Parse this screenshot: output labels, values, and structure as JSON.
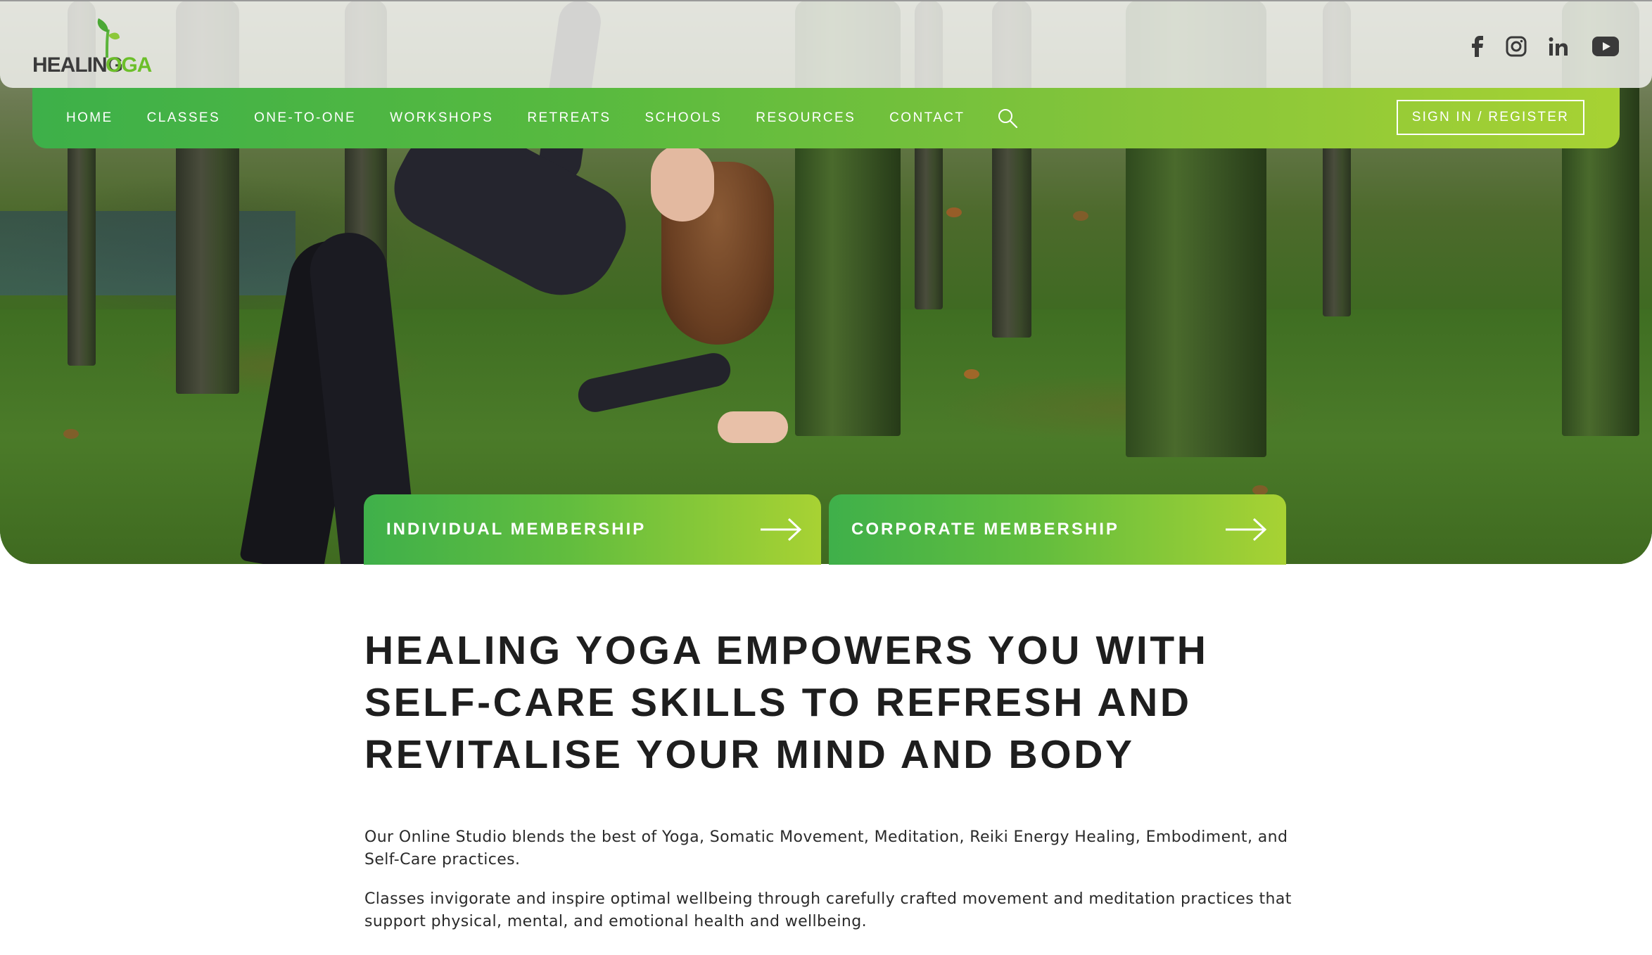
{
  "brand": {
    "logo_text_left": "HEALING",
    "logo_text_right": "OGA",
    "accent_green": "#5bbf3f",
    "accent_lime": "#a7d233"
  },
  "social": [
    {
      "name": "facebook",
      "icon": "facebook-icon"
    },
    {
      "name": "instagram",
      "icon": "instagram-icon"
    },
    {
      "name": "linkedin",
      "icon": "linkedin-icon"
    },
    {
      "name": "youtube",
      "icon": "youtube-icon"
    }
  ],
  "nav": {
    "items": [
      {
        "label": "HOME"
      },
      {
        "label": "CLASSES"
      },
      {
        "label": "ONE-TO-ONE"
      },
      {
        "label": "WORKSHOPS"
      },
      {
        "label": "RETREATS"
      },
      {
        "label": "SCHOOLS"
      },
      {
        "label": "RESOURCES"
      },
      {
        "label": "CONTACT"
      }
    ],
    "search_icon": "search-icon",
    "signin_label": "SIGN IN / REGISTER"
  },
  "membership": {
    "individual_label": "INDIVIDUAL MEMBERSHIP",
    "corporate_label": "CORPORATE MEMBERSHIP",
    "arrow_icon": "arrow-right-icon"
  },
  "content": {
    "headline_line1": "HEALING YOGA EMPOWERS YOU WITH",
    "headline_line2": "SELF-CARE SKILLS TO REFRESH AND",
    "headline_line3": "REVITALISE YOUR MIND AND BODY",
    "paragraph1": "Our Online Studio blends the best of Yoga, Somatic Movement, Meditation, Reiki Energy Healing, Embodiment, and Self-Care practices.",
    "paragraph2": "Classes invigorate and inspire optimal wellbeing through carefully crafted movement and meditation practices that support physical, mental, and emotional health and wellbeing."
  }
}
